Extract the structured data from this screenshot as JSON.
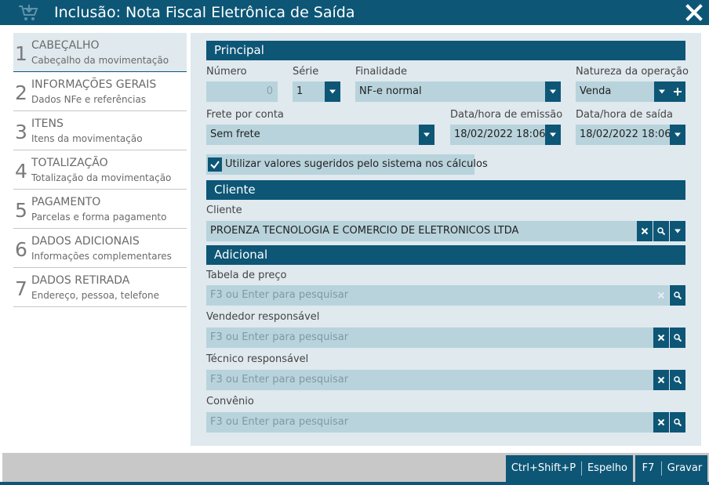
{
  "window": {
    "title": "Inclusão: Nota Fiscal Eletrônica de Saída"
  },
  "nav": {
    "items": [
      {
        "num": "1",
        "title": "CABEÇALHO",
        "sub": "Cabeçalho da movimentação",
        "active": true
      },
      {
        "num": "2",
        "title": "INFORMAÇÕES GERAIS",
        "sub": "Dados NFe e referências"
      },
      {
        "num": "3",
        "title": "ITENS",
        "sub": "Itens da movimentação"
      },
      {
        "num": "4",
        "title": "TOTALIZAÇÃO",
        "sub": "Totalização da movimentação"
      },
      {
        "num": "5",
        "title": "PAGAMENTO",
        "sub": "Parcelas e forma pagamento"
      },
      {
        "num": "6",
        "title": "DADOS ADICIONAIS",
        "sub": "Informações complementares"
      },
      {
        "num": "7",
        "title": "DADOS RETIRADA",
        "sub": "Endereço, pessoa, telefone"
      }
    ]
  },
  "principal": {
    "header": "Principal",
    "numero": {
      "label": "Número",
      "value": "0"
    },
    "serie": {
      "label": "Série",
      "value": "1"
    },
    "finalidade": {
      "label": "Finalidade",
      "value": "NF-e normal"
    },
    "natureza": {
      "label": "Natureza da operação",
      "value": "Venda"
    },
    "frete": {
      "label": "Frete por conta",
      "value": "Sem frete"
    },
    "emissao": {
      "label": "Data/hora de emissão",
      "value": "18/02/2022 18:06"
    },
    "saida": {
      "label": "Data/hora de saída",
      "value": "18/02/2022 18:06"
    },
    "sugeridos": {
      "label": "Utilizar valores sugeridos pelo sistema nos cálculos",
      "checked": true
    }
  },
  "cliente": {
    "header": "Cliente",
    "label": "Cliente",
    "value": "PROENZA TECNOLOGIA E COMERCIO DE ELETRONICOS LTDA"
  },
  "adicional": {
    "header": "Adicional",
    "tabela": {
      "label": "Tabela de preço",
      "placeholder": "F3 ou Enter para pesquisar"
    },
    "vendedor": {
      "label": "Vendedor responsável",
      "placeholder": "F3 ou Enter para pesquisar"
    },
    "tecnico": {
      "label": "Técnico responsável",
      "placeholder": "F3 ou Enter para pesquisar"
    },
    "convenio": {
      "label": "Convênio",
      "placeholder": "F3 ou Enter para pesquisar"
    }
  },
  "footer": {
    "espelho_shortcut": "Ctrl+Shift+P",
    "espelho_label": "Espelho",
    "gravar_shortcut": "F7",
    "gravar_label": "Gravar"
  },
  "colors": {
    "primary": "#0d5676",
    "field": "#b8d3dc",
    "panel": "#dfe9ee"
  }
}
